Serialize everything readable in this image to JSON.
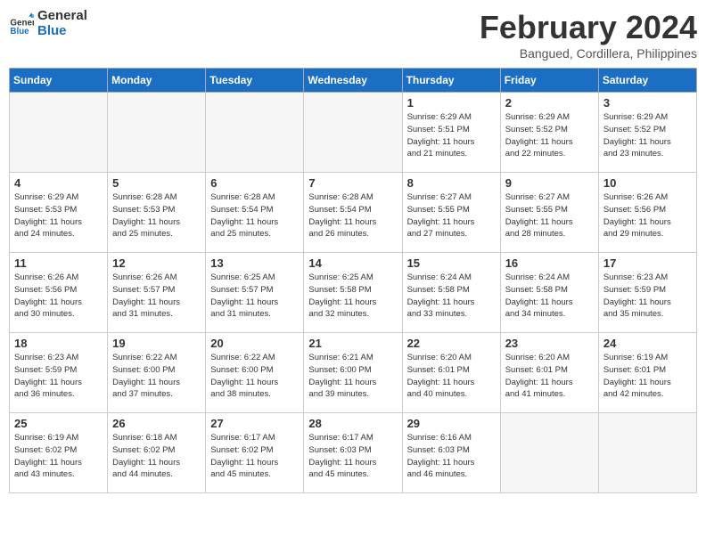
{
  "logo": {
    "line1": "General",
    "line2": "Blue"
  },
  "title": "February 2024",
  "subtitle": "Bangued, Cordillera, Philippines",
  "weekdays": [
    "Sunday",
    "Monday",
    "Tuesday",
    "Wednesday",
    "Thursday",
    "Friday",
    "Saturday"
  ],
  "weeks": [
    [
      {
        "day": "",
        "info": ""
      },
      {
        "day": "",
        "info": ""
      },
      {
        "day": "",
        "info": ""
      },
      {
        "day": "",
        "info": ""
      },
      {
        "day": "1",
        "info": "Sunrise: 6:29 AM\nSunset: 5:51 PM\nDaylight: 11 hours\nand 21 minutes."
      },
      {
        "day": "2",
        "info": "Sunrise: 6:29 AM\nSunset: 5:52 PM\nDaylight: 11 hours\nand 22 minutes."
      },
      {
        "day": "3",
        "info": "Sunrise: 6:29 AM\nSunset: 5:52 PM\nDaylight: 11 hours\nand 23 minutes."
      }
    ],
    [
      {
        "day": "4",
        "info": "Sunrise: 6:29 AM\nSunset: 5:53 PM\nDaylight: 11 hours\nand 24 minutes."
      },
      {
        "day": "5",
        "info": "Sunrise: 6:28 AM\nSunset: 5:53 PM\nDaylight: 11 hours\nand 25 minutes."
      },
      {
        "day": "6",
        "info": "Sunrise: 6:28 AM\nSunset: 5:54 PM\nDaylight: 11 hours\nand 25 minutes."
      },
      {
        "day": "7",
        "info": "Sunrise: 6:28 AM\nSunset: 5:54 PM\nDaylight: 11 hours\nand 26 minutes."
      },
      {
        "day": "8",
        "info": "Sunrise: 6:27 AM\nSunset: 5:55 PM\nDaylight: 11 hours\nand 27 minutes."
      },
      {
        "day": "9",
        "info": "Sunrise: 6:27 AM\nSunset: 5:55 PM\nDaylight: 11 hours\nand 28 minutes."
      },
      {
        "day": "10",
        "info": "Sunrise: 6:26 AM\nSunset: 5:56 PM\nDaylight: 11 hours\nand 29 minutes."
      }
    ],
    [
      {
        "day": "11",
        "info": "Sunrise: 6:26 AM\nSunset: 5:56 PM\nDaylight: 11 hours\nand 30 minutes."
      },
      {
        "day": "12",
        "info": "Sunrise: 6:26 AM\nSunset: 5:57 PM\nDaylight: 11 hours\nand 31 minutes."
      },
      {
        "day": "13",
        "info": "Sunrise: 6:25 AM\nSunset: 5:57 PM\nDaylight: 11 hours\nand 31 minutes."
      },
      {
        "day": "14",
        "info": "Sunrise: 6:25 AM\nSunset: 5:58 PM\nDaylight: 11 hours\nand 32 minutes."
      },
      {
        "day": "15",
        "info": "Sunrise: 6:24 AM\nSunset: 5:58 PM\nDaylight: 11 hours\nand 33 minutes."
      },
      {
        "day": "16",
        "info": "Sunrise: 6:24 AM\nSunset: 5:58 PM\nDaylight: 11 hours\nand 34 minutes."
      },
      {
        "day": "17",
        "info": "Sunrise: 6:23 AM\nSunset: 5:59 PM\nDaylight: 11 hours\nand 35 minutes."
      }
    ],
    [
      {
        "day": "18",
        "info": "Sunrise: 6:23 AM\nSunset: 5:59 PM\nDaylight: 11 hours\nand 36 minutes."
      },
      {
        "day": "19",
        "info": "Sunrise: 6:22 AM\nSunset: 6:00 PM\nDaylight: 11 hours\nand 37 minutes."
      },
      {
        "day": "20",
        "info": "Sunrise: 6:22 AM\nSunset: 6:00 PM\nDaylight: 11 hours\nand 38 minutes."
      },
      {
        "day": "21",
        "info": "Sunrise: 6:21 AM\nSunset: 6:00 PM\nDaylight: 11 hours\nand 39 minutes."
      },
      {
        "day": "22",
        "info": "Sunrise: 6:20 AM\nSunset: 6:01 PM\nDaylight: 11 hours\nand 40 minutes."
      },
      {
        "day": "23",
        "info": "Sunrise: 6:20 AM\nSunset: 6:01 PM\nDaylight: 11 hours\nand 41 minutes."
      },
      {
        "day": "24",
        "info": "Sunrise: 6:19 AM\nSunset: 6:01 PM\nDaylight: 11 hours\nand 42 minutes."
      }
    ],
    [
      {
        "day": "25",
        "info": "Sunrise: 6:19 AM\nSunset: 6:02 PM\nDaylight: 11 hours\nand 43 minutes."
      },
      {
        "day": "26",
        "info": "Sunrise: 6:18 AM\nSunset: 6:02 PM\nDaylight: 11 hours\nand 44 minutes."
      },
      {
        "day": "27",
        "info": "Sunrise: 6:17 AM\nSunset: 6:02 PM\nDaylight: 11 hours\nand 45 minutes."
      },
      {
        "day": "28",
        "info": "Sunrise: 6:17 AM\nSunset: 6:03 PM\nDaylight: 11 hours\nand 45 minutes."
      },
      {
        "day": "29",
        "info": "Sunrise: 6:16 AM\nSunset: 6:03 PM\nDaylight: 11 hours\nand 46 minutes."
      },
      {
        "day": "",
        "info": ""
      },
      {
        "day": "",
        "info": ""
      }
    ]
  ]
}
